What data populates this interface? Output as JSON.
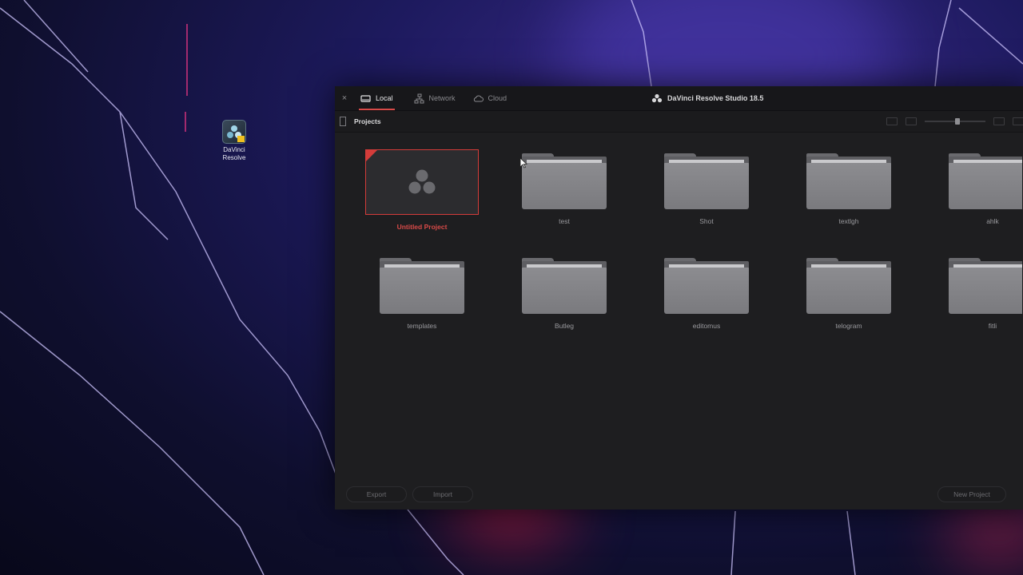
{
  "desktop": {
    "icon_label_line1": "DaVinci",
    "icon_label_line2": "Resolve",
    "icon": "davinci-resolve-shortcut-icon"
  },
  "window": {
    "tabs": [
      {
        "label": "Local",
        "icon": "drive-icon",
        "active": true
      },
      {
        "label": "Network",
        "icon": "network-icon",
        "active": false
      },
      {
        "label": "Cloud",
        "icon": "cloud-icon",
        "active": false
      }
    ],
    "app_title": "DaVinci Resolve Studio 18.5",
    "close": "×",
    "subbar_title": "Projects"
  },
  "projects": [
    {
      "name": "Untitled Project",
      "type": "project",
      "selected": true
    },
    {
      "name": "test",
      "type": "folder"
    },
    {
      "name": "Shot",
      "type": "folder"
    },
    {
      "name": "textlgh",
      "type": "folder"
    },
    {
      "name": "ahlk",
      "type": "folder"
    },
    {
      "name": "templates",
      "type": "folder"
    },
    {
      "name": "Butleg",
      "type": "folder"
    },
    {
      "name": "editomus",
      "type": "folder"
    },
    {
      "name": "telogram",
      "type": "folder"
    },
    {
      "name": "fitli",
      "type": "folder"
    }
  ],
  "buttons": {
    "export": "Export",
    "import": "Import",
    "new_project": "New Project"
  },
  "colors": {
    "accent_red": "#d43c3a",
    "window_bg": "#1e1e20"
  }
}
